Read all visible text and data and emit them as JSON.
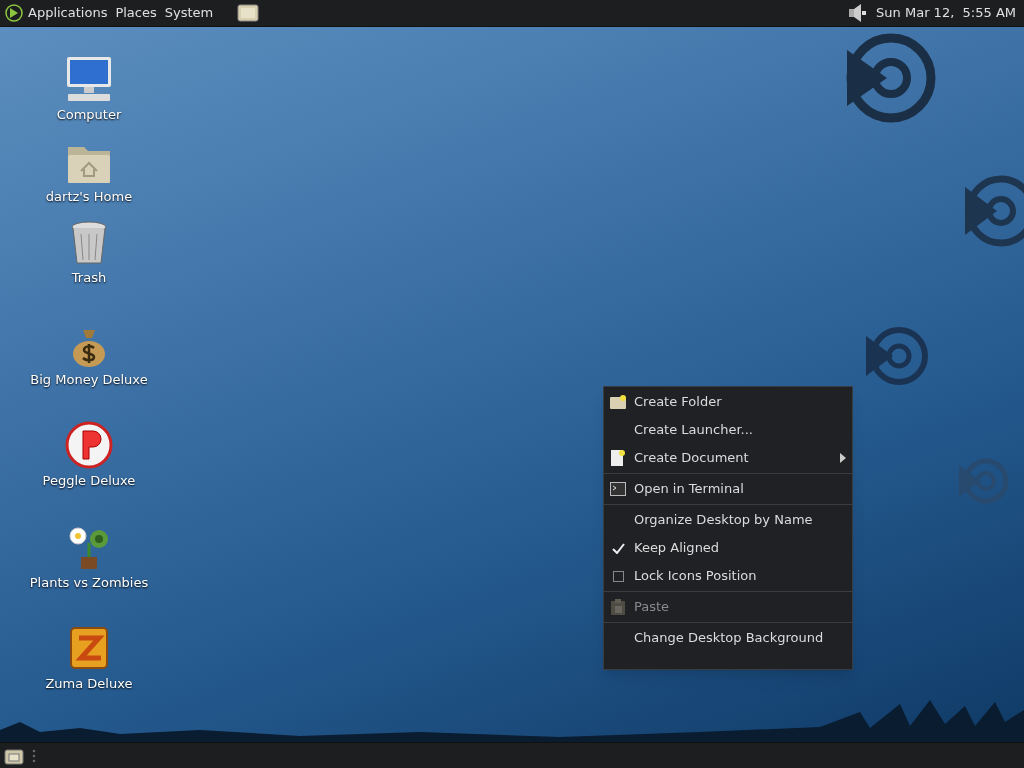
{
  "top_panel": {
    "menus": [
      "Applications",
      "Places",
      "System"
    ],
    "clock": "Sun Mar 12,  5:55 AM"
  },
  "desktop": {
    "system_icons": [
      {
        "kind": "computer",
        "label": "Computer"
      },
      {
        "kind": "home",
        "label": "dartz's Home"
      },
      {
        "kind": "trash",
        "label": "Trash"
      }
    ],
    "launchers": [
      {
        "kind": "moneybag",
        "label": "Big Money Deluxe"
      },
      {
        "kind": "peggle",
        "label": "Peggle Deluxe"
      },
      {
        "kind": "plant",
        "label": "Plants vs Zombies"
      },
      {
        "kind": "zuma",
        "label": "Zuma Deluxe"
      }
    ]
  },
  "context_menu": [
    {
      "kind": "item",
      "label": "Create Folder",
      "submenu": false,
      "disabled": false
    },
    {
      "kind": "item",
      "label": "Create Launcher...",
      "submenu": false,
      "disabled": false
    },
    {
      "kind": "item",
      "label": "Create Document",
      "submenu": true,
      "disabled": false
    },
    {
      "kind": "separator"
    },
    {
      "kind": "item",
      "label": "Open in Terminal",
      "submenu": false,
      "disabled": false
    },
    {
      "kind": "separator"
    },
    {
      "kind": "item",
      "label": "Organize Desktop by Name",
      "submenu": false,
      "disabled": false
    },
    {
      "kind": "check",
      "label": "Keep Aligned",
      "checked": true
    },
    {
      "kind": "check",
      "label": "Lock Icons Position",
      "checked": false
    },
    {
      "kind": "separator"
    },
    {
      "kind": "item",
      "label": "Paste",
      "submenu": false,
      "disabled": true
    },
    {
      "kind": "separator"
    },
    {
      "kind": "item",
      "label": "Change Desktop Background",
      "submenu": false,
      "disabled": false
    }
  ]
}
